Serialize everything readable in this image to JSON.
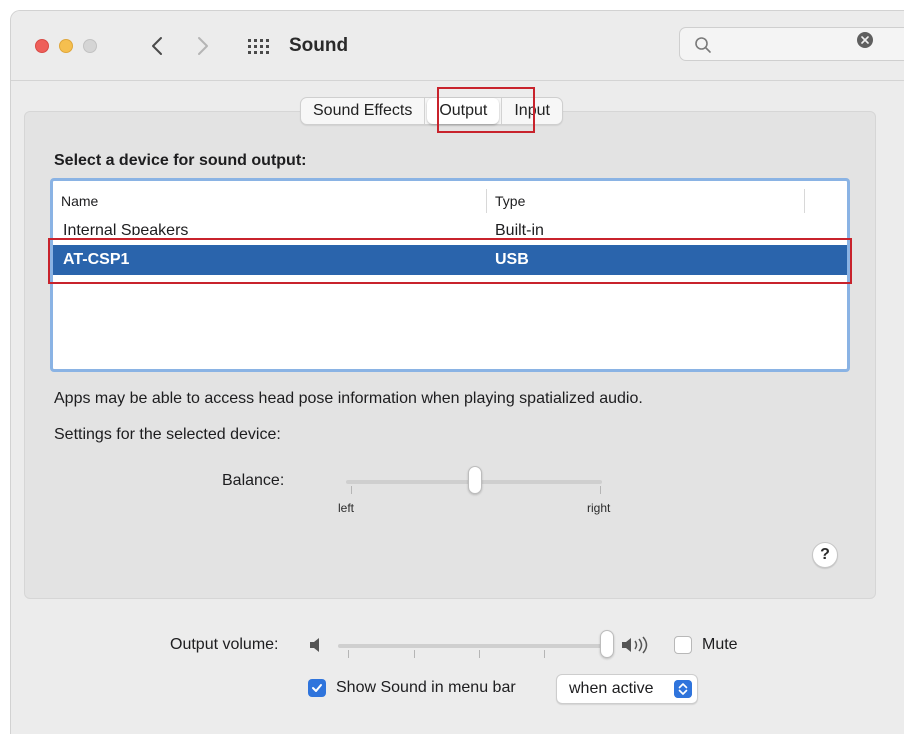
{
  "window": {
    "title": "Sound"
  },
  "search": {
    "placeholder": ""
  },
  "tabs": [
    {
      "label": "Sound Effects",
      "active": false
    },
    {
      "label": "Output",
      "active": true
    },
    {
      "label": "Input",
      "active": false
    }
  ],
  "output": {
    "section_title": "Select a device for sound output:",
    "columns": {
      "name": "Name",
      "type": "Type"
    },
    "devices": [
      {
        "name": "Internal Speakers",
        "type": "Built-in",
        "selected": false
      },
      {
        "name": "AT-CSP1",
        "type": "USB",
        "selected": true
      }
    ],
    "info_text": "Apps may be able to access head pose information when playing spatialized audio.",
    "settings_label": "Settings for the selected device:",
    "balance": {
      "label": "Balance:",
      "left_label": "left",
      "right_label": "right",
      "value": 0.5
    },
    "help_label": "?"
  },
  "footer": {
    "volume_label": "Output volume:",
    "volume_value": 1.0,
    "mute_label": "Mute",
    "mute_checked": false,
    "menu_bar_label": "Show Sound in menu bar",
    "menu_bar_checked": true,
    "menu_bar_option": "when active"
  },
  "colors": {
    "selection": "#2a64ac",
    "accent": "#2f74dc",
    "highlight_box": "#c8232c",
    "traffic_red": "#ee5f5a",
    "traffic_yellow": "#f5bf4f"
  },
  "icons": [
    "back-chevron-icon",
    "forward-chevron-icon",
    "grid-icon",
    "search-icon",
    "clear-icon",
    "speaker-low-icon",
    "speaker-high-icon",
    "checkmark-icon",
    "select-arrows-icon"
  ]
}
